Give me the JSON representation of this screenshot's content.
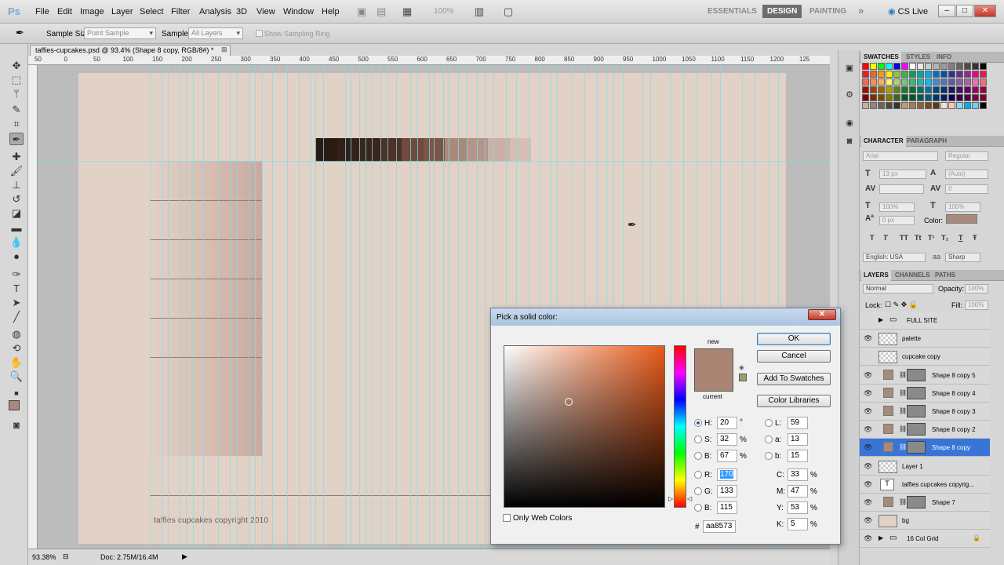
{
  "menubar": {
    "logo": "Ps",
    "items": [
      "File",
      "Edit",
      "Image",
      "Layer",
      "Select",
      "Filter",
      "Analysis",
      "3D",
      "View",
      "Window",
      "Help"
    ],
    "zoom": "100%",
    "workspaces": [
      "ESSENTIALS",
      "DESIGN",
      "PAINTING"
    ],
    "more": "»",
    "cs_live": "CS Live",
    "window_buttons": [
      "–",
      "□",
      "✕"
    ]
  },
  "options": {
    "sample_size_label": "Sample Size:",
    "sample_size_value": "Point Sample",
    "sample_label": "Sample:",
    "sample_value": "All Layers",
    "show_ring": "Show Sampling Ring"
  },
  "document": {
    "tab_title": "taffies-cupcakes.psd @ 93.4% (Shape 8 copy, RGB/8#) *",
    "tab_close": "⊠",
    "ruler_ticks": [
      "50",
      "0",
      "50",
      "100",
      "150",
      "200",
      "250",
      "300",
      "350",
      "400",
      "450",
      "500",
      "550",
      "600",
      "650",
      "700",
      "750",
      "800",
      "850",
      "900",
      "950",
      "1000",
      "1050",
      "1100",
      "1150",
      "1200",
      "125"
    ],
    "copyright_text": "taffies cupcakes   copyright   2010",
    "gradient_colors": [
      "#2b1914",
      "#33201a",
      "#3c251d",
      "#4e3127",
      "#6e4b3f",
      "#7a5648",
      "#a88a7c",
      "#b4958a",
      "#cbb0a5",
      "#d6beb4"
    ]
  },
  "status": {
    "zoom": "93.38%",
    "doc_size": "Doc: 2.75M/16.4M"
  },
  "swatches_panel": {
    "tabs": [
      "SWATCHES",
      "STYLES",
      "INFO"
    ],
    "colors": [
      "#ff0000",
      "#ffff00",
      "#00ff00",
      "#00ffff",
      "#0000ff",
      "#ff00ff",
      "#ffffff",
      "#e6e6e6",
      "#cccccc",
      "#b3b3b3",
      "#999999",
      "#808080",
      "#666666",
      "#4d4d4d",
      "#333333",
      "#000000",
      "#ed1c24",
      "#f26522",
      "#f7941d",
      "#fff200",
      "#8dc63f",
      "#39b54a",
      "#00a651",
      "#00a99d",
      "#00aeef",
      "#0072bc",
      "#0054a6",
      "#2e3192",
      "#662d91",
      "#92278f",
      "#ec008c",
      "#ed145b",
      "#f26c4f",
      "#f68e56",
      "#fbaf5d",
      "#fff568",
      "#acd373",
      "#7cc576",
      "#3bb878",
      "#1abbb4",
      "#00bff3",
      "#438ccb",
      "#5574b9",
      "#605ca8",
      "#8560a8",
      "#a763a8",
      "#f06eaa",
      "#f26d7d",
      "#9e0b0f",
      "#a0410d",
      "#a36209",
      "#aba000",
      "#598527",
      "#197b30",
      "#007236",
      "#00746b",
      "#0076a3",
      "#004a80",
      "#003471",
      "#1b1464",
      "#440e62",
      "#630460",
      "#9e005d",
      "#9e0039",
      "#790000",
      "#7b2e00",
      "#7d4900",
      "#827b00",
      "#406618",
      "#005e20",
      "#005826",
      "#005952",
      "#005b7f",
      "#003663",
      "#002157",
      "#0d004c",
      "#32004b",
      "#4b0049",
      "#7b0046",
      "#7a0026",
      "#c7b299",
      "#998675",
      "#736357",
      "#534741",
      "#37302d",
      "#c69c6d",
      "#a67c52",
      "#8c6239",
      "#754c24",
      "#603913",
      "#fbdfd5",
      "#f9c6b5",
      "#8ed8f8",
      "#00aeef",
      "#6dcff6",
      "#000000"
    ]
  },
  "character_panel": {
    "tabs": [
      "CHARACTER",
      "PARAGRAPH"
    ],
    "font_family": "Arial",
    "font_style": "Regular",
    "font_size": "13 px",
    "leading": "(Auto)",
    "tracking": "0",
    "vscale": "100%",
    "hscale": "100%",
    "baseline": "0 px",
    "color_label": "Color:",
    "format_buttons": [
      "T",
      "T",
      "TT",
      "Tt",
      "T¹",
      "T₁",
      "T",
      "Ŧ"
    ],
    "language": "English: USA",
    "aa_label": "aa",
    "antialias": "Sharp"
  },
  "layers_panel": {
    "tabs": [
      "LAYERS",
      "CHANNELS",
      "PATHS"
    ],
    "blend_mode": "Normal",
    "opacity_label": "Opacity:",
    "opacity_value": "100%",
    "lock_label": "Lock:",
    "fill_label": "Fill:",
    "fill_value": "100%",
    "layers": [
      {
        "name": "FULL SITE",
        "type": "group",
        "visible": false
      },
      {
        "name": "palette",
        "type": "pixel",
        "visible": true
      },
      {
        "name": "cupcake copy",
        "type": "pixel",
        "visible": false
      },
      {
        "name": "Shape 8 copy 5",
        "type": "shape",
        "visible": true
      },
      {
        "name": "Shape 8 copy 4",
        "type": "shape",
        "visible": true
      },
      {
        "name": "Shape 8 copy 3",
        "type": "shape",
        "visible": true
      },
      {
        "name": "Shape 8 copy 2",
        "type": "shape",
        "visible": true
      },
      {
        "name": "Shape 8 copy",
        "type": "shape",
        "visible": true,
        "selected": true
      },
      {
        "name": "Layer 1",
        "type": "pixel",
        "visible": true
      },
      {
        "name": "taffies cupcakes   copyrig...",
        "type": "text",
        "visible": true
      },
      {
        "name": "Shape 7",
        "type": "shape",
        "visible": true
      },
      {
        "name": "bg",
        "type": "fill",
        "visible": true
      },
      {
        "name": "16 Col Grid",
        "type": "group",
        "visible": true
      }
    ]
  },
  "color_picker": {
    "title": "Pick a solid color:",
    "close": "✕",
    "new_label": "new",
    "current_label": "current",
    "swatch_color": "#aa8573",
    "buttons": {
      "ok": "OK",
      "cancel": "Cancel",
      "add_swatches": "Add To Swatches",
      "libraries": "Color Libraries"
    },
    "hsb": {
      "h": "20",
      "s": "32",
      "b": "67",
      "h_unit": "°",
      "pct": "%"
    },
    "rgb": {
      "r": "170",
      "g": "133",
      "b": "115"
    },
    "lab": {
      "l": "59",
      "a": "13",
      "b": "15"
    },
    "cmyk": {
      "c": "33",
      "m": "47",
      "y": "53",
      "k": "5"
    },
    "labels": {
      "H": "H:",
      "S": "S:",
      "B": "B:",
      "R": "R:",
      "G": "G:",
      "Bl": "B:",
      "L": "L:",
      "a": "a:",
      "b": "b:",
      "C": "C:",
      "M": "M:",
      "Y": "Y:",
      "K": "K:"
    },
    "only_web": "Only Web Colors",
    "hex_label": "#",
    "hex": "aa8573"
  }
}
